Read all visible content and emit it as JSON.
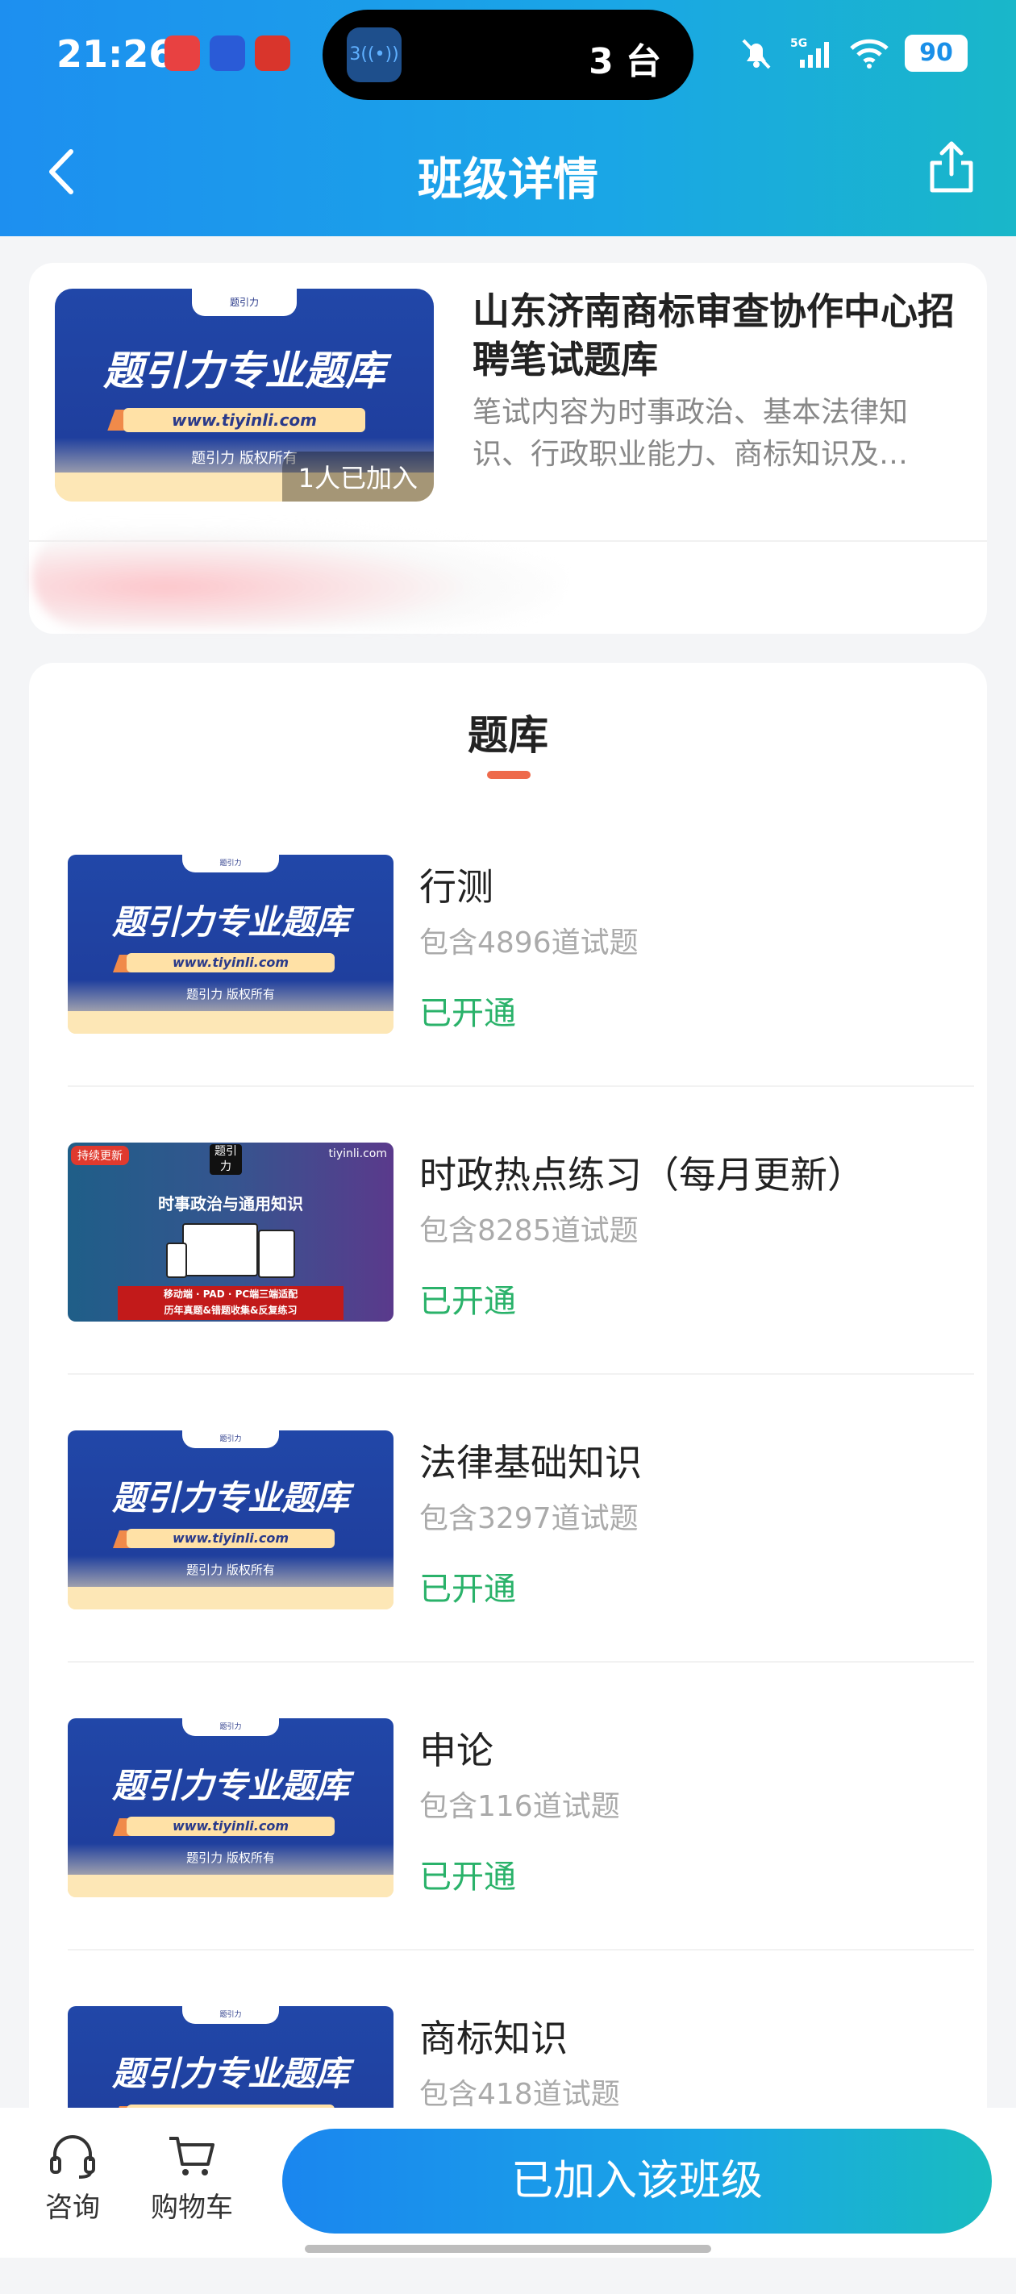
{
  "status_bar": {
    "time": "21:26",
    "island_badge": "3",
    "island_text": "3 台",
    "network": "5G",
    "battery": "90"
  },
  "nav": {
    "title": "班级详情"
  },
  "class_info": {
    "cover": {
      "title": "题引力专业题库",
      "url": "www.tiyinli.com",
      "copyright": "题引力 版权所有",
      "brand_small": "题引力"
    },
    "joined_badge": "1人已加入",
    "title": "山东济南商标审查协作中心招聘笔试题库",
    "description": "笔试内容为时事政治、基本法律知识、行政职业能力、商标知识及…"
  },
  "bank": {
    "title": "题库",
    "items": [
      {
        "name": "行测",
        "count": "包含4896道试题",
        "status": "已开通"
      },
      {
        "name": "时政热点练习（每月更新）",
        "count": "包含8285道试题",
        "status": "已开通"
      },
      {
        "name": "法律基础知识",
        "count": "包含3297道试题",
        "status": "已开通"
      },
      {
        "name": "申论",
        "count": "包含116道试题",
        "status": "已开通"
      },
      {
        "name": "商标知识",
        "count": "包含418道试题",
        "status": ""
      }
    ],
    "special_cover": {
      "tag": "持续更新",
      "brand": "题引力",
      "site": "tiyinli.com",
      "headline": "时事政治与通用知识",
      "banner_line1": "移动端 · PAD · PC端三端适配",
      "banner_line2": "历年真题&错题收集&反复练习"
    }
  },
  "bottom_bar": {
    "consult_label": "咨询",
    "cart_label": "购物车",
    "join_button": "已加入该班级"
  },
  "colors": {
    "header_start": "#1d8ff0",
    "header_end": "#19b7c9",
    "opened_green": "#2ab26a",
    "tab_underline": "#ee6a4b"
  }
}
